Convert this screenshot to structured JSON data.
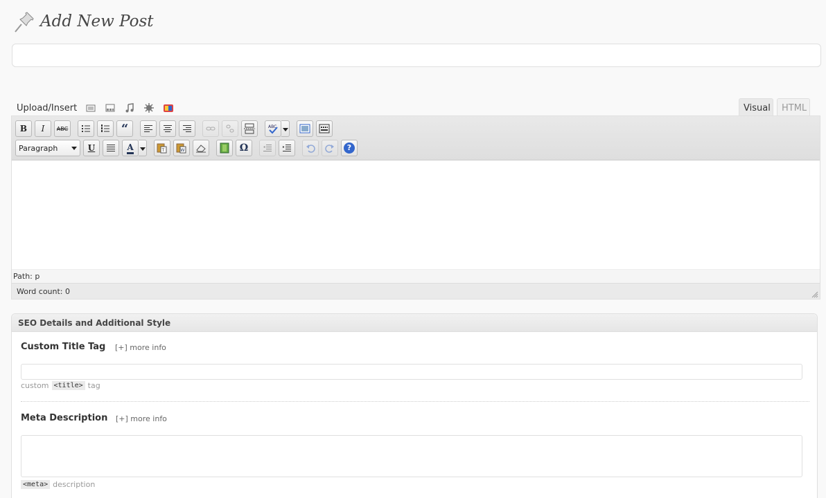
{
  "header": {
    "title": "Add New Post",
    "icon": "pushpin-icon"
  },
  "title_input": {
    "value": "",
    "placeholder": ""
  },
  "media": {
    "label": "Upload/Insert",
    "icons": [
      "add-image-icon",
      "add-video-icon",
      "add-audio-icon",
      "add-media-icon",
      "add-gallery-icon"
    ]
  },
  "tabs": {
    "visual": "Visual",
    "html": "HTML",
    "active": "visual"
  },
  "toolbar": {
    "row1": [
      "B",
      "I",
      "ABC",
      "bullet-list",
      "number-list",
      "“",
      "align-left",
      "align-center",
      "align-right",
      "link",
      "unlink",
      "more",
      "spellcheck",
      "fullscreen",
      "kitchen-sink"
    ],
    "format_select": "Paragraph",
    "row2": [
      "U",
      "justify",
      "A",
      "paste-text",
      "paste-word",
      "remove-format",
      "media",
      "Ω",
      "outdent",
      "indent",
      "undo",
      "redo",
      "?"
    ]
  },
  "editor": {
    "path_label": "Path: p",
    "word_count": "Word count: 0"
  },
  "seo": {
    "heading": "SEO Details and Additional Style",
    "title_tag": {
      "label": "Custom Title Tag",
      "more_info": "[+] more info",
      "value": "",
      "hint_pre": "custom",
      "hint_code": "<title>",
      "hint_post": "tag"
    },
    "meta_description": {
      "label": "Meta Description",
      "more_info": "[+] more info",
      "value": "",
      "hint_code": "<meta>",
      "hint_post": "description"
    }
  },
  "colors": {
    "accent": "#21759b",
    "background": "#f9f9f9",
    "border": "#dfdfdf"
  }
}
